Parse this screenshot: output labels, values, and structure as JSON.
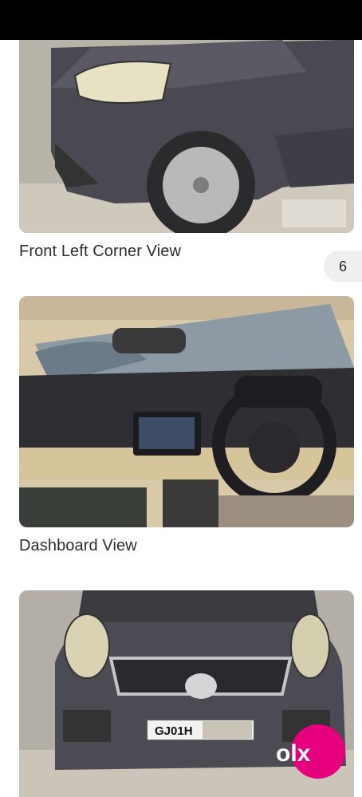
{
  "gallery": {
    "items": [
      {
        "caption": "Front Left Corner View"
      },
      {
        "caption": "Dashboard View"
      },
      {
        "caption": ""
      }
    ],
    "counter": "6"
  },
  "vehicle": {
    "plate": "GJ01H"
  },
  "brand": {
    "logo_text": "olx",
    "accent": "#e6007e",
    "logo_color": "#ffffff"
  }
}
